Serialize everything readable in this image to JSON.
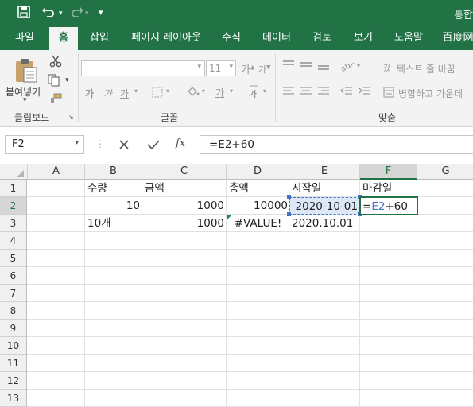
{
  "app": {
    "title": "통합"
  },
  "tabs": [
    "파일",
    "홈",
    "삽입",
    "페이지 레이아웃",
    "수식",
    "데이터",
    "검토",
    "보기",
    "도움말",
    "百度网"
  ],
  "ribbon": {
    "clipboard": {
      "paste_label": "붙여넣기",
      "group_label": "클립보드"
    },
    "font": {
      "font_size": "11",
      "bold": "가",
      "italic": "가",
      "underline": "가",
      "font_color": "가",
      "group_label": "글꼴"
    },
    "alignment": {
      "wrap_text": "텍스트 줄 바꿈",
      "merge_center": "병합하고 가운데",
      "group_label": "맞춤"
    }
  },
  "formula_bar": {
    "name_box": "F2",
    "formula": "=E2+60",
    "fx": "fx"
  },
  "sheet": {
    "columns": [
      "A",
      "B",
      "C",
      "D",
      "E",
      "F",
      "G"
    ],
    "rows": [
      "1",
      "2",
      "3",
      "4",
      "5",
      "6",
      "7",
      "8",
      "9",
      "10",
      "11",
      "12",
      "13"
    ],
    "cells": {
      "B1": "수량",
      "C1": "금액",
      "D1": "총액",
      "E1": "시작일",
      "F1": "마감일",
      "B2": "10",
      "C2": "1000",
      "D2": "10000",
      "E2": "2020-10-01",
      "F2": {
        "eq": "=",
        "ref": "E2",
        "rest": "+60"
      },
      "B3": "10개",
      "C3": "1000",
      "D3": "#VALUE!",
      "E3": "2020.10.01"
    },
    "selected_cell": "F2",
    "ref_highlight_color": "#4472c4",
    "accent_color": "#217346"
  }
}
